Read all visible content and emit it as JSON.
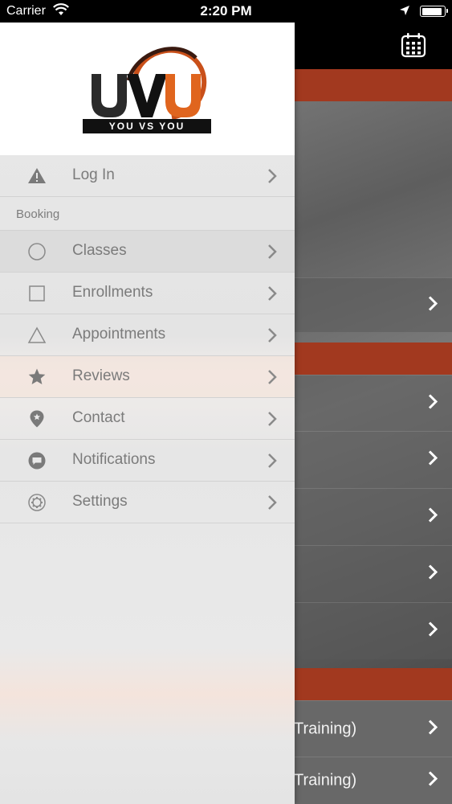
{
  "status_bar": {
    "carrier": "Carrier",
    "time": "2:20 PM"
  },
  "logo": {
    "letters": "UVU",
    "tagline": "YOU VS YOU"
  },
  "drawer": {
    "login": {
      "label": "Log In",
      "icon": "warning-icon"
    },
    "section_header": "Booking",
    "items": [
      {
        "label": "Classes",
        "icon": "circle-icon"
      },
      {
        "label": "Enrollments",
        "icon": "square-icon"
      },
      {
        "label": "Appointments",
        "icon": "triangle-icon"
      },
      {
        "label": "Reviews",
        "icon": "star-icon"
      },
      {
        "label": "Contact",
        "icon": "location-pin-icon"
      },
      {
        "label": "Notifications",
        "icon": "chat-bubble-icon"
      },
      {
        "label": "Settings",
        "icon": "gear-icon"
      }
    ]
  },
  "background_list": {
    "partial_row_1": "Training)",
    "partial_row_2": "Training)"
  },
  "colors": {
    "accent_orange": "#a2391f",
    "logo_orange": "#e0651e",
    "text_gray": "#7b7b7b"
  }
}
